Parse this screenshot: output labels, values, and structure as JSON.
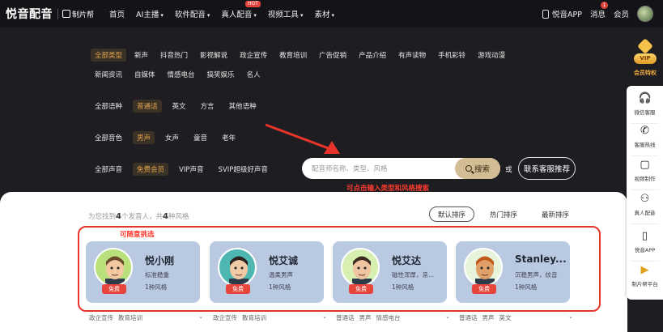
{
  "header": {
    "logo_text": "悦音配音",
    "logo_sub": "制片帮",
    "nav": [
      {
        "label": "首页",
        "chevron": false,
        "hot": ""
      },
      {
        "label": "AI主播",
        "chevron": true,
        "hot": ""
      },
      {
        "label": "软件配音",
        "chevron": true,
        "hot": ""
      },
      {
        "label": "真人配音",
        "chevron": true,
        "hot": "HOT"
      },
      {
        "label": "视频工具",
        "chevron": true,
        "hot": ""
      },
      {
        "label": "素材",
        "chevron": true,
        "hot": ""
      }
    ],
    "app_label": "悦音APP",
    "messages_label": "消息",
    "messages_badge": "1",
    "member_label": "会员"
  },
  "filters": {
    "type_row1": [
      "全部类型",
      "新声",
      "抖音热门",
      "影视解说",
      "政企宣传",
      "教育培训",
      "广告促销",
      "产品介绍",
      "有声读物",
      "手机彩铃",
      "游戏动漫"
    ],
    "type_row2": [
      "新闻资讯",
      "自媒体",
      "情感电台",
      "搞笑娱乐",
      "名人"
    ],
    "language": [
      "全部语种",
      "普通话",
      "英文",
      "方言",
      "其他语种"
    ],
    "voice": [
      "全部音色",
      "男声",
      "女声",
      "童音",
      "老年"
    ],
    "member": [
      "全部声音",
      "免费会员",
      "VIP声音",
      "SVIP超级好声音"
    ]
  },
  "search": {
    "placeholder": "配音师名称、类型、风格",
    "button_label": "搜索",
    "or_label": "或",
    "cs_button_label": "联系客服推荐",
    "hint": "可点击输入类型和风格搜索"
  },
  "results": {
    "count_prefix": "为您找到",
    "count_voices": "4",
    "count_mid": "个发音人，共",
    "count_styles": "4",
    "count_suffix": "种风格",
    "sort_options": [
      "默认排序",
      "热门排序",
      "最新排序"
    ],
    "pick_label": "可随意挑选",
    "free_label": "免费",
    "cards": [
      {
        "name": "悦小刚",
        "desc": "标准稳重",
        "styles": "1种风格",
        "tags": [
          "政企宣传",
          "教育培训"
        ],
        "avatar_bg": "#b9e07a",
        "skin": "#f1c8a0",
        "hair": "#6b4a2b"
      },
      {
        "name": "悦艾诚",
        "desc": "温柔男声",
        "styles": "1种风格",
        "tags": [
          "政企宣传",
          "教育培训"
        ],
        "avatar_bg": "#4fb7b1",
        "skin": "#f0c9a6",
        "hair": "#2a2321"
      },
      {
        "name": "悦艾达",
        "desc": "磁性浑厚，亲...",
        "styles": "1种风格",
        "tags": [
          "普通话",
          "男声",
          "情感电台"
        ],
        "avatar_bg": "#d7efb0",
        "skin": "#efc4a0",
        "hair": "#3a2a22"
      },
      {
        "name": "Stanley...",
        "desc": "沉稳男声，纹音",
        "styles": "1种风格",
        "tags": [
          "普通话",
          "男声",
          "英文"
        ],
        "avatar_bg": "#e7f3da",
        "skin": "#e1a06a",
        "hair": "#c05a1a"
      }
    ]
  },
  "rail": {
    "vip_badge": "VIP",
    "vip_label": "会员特权",
    "items": [
      {
        "label": "微信客服",
        "icon": "headset-icon",
        "glyph": "🎧"
      },
      {
        "label": "客服热线",
        "icon": "phone-icon",
        "glyph": "✆"
      },
      {
        "label": "视频制作",
        "icon": "video-icon",
        "glyph": "▢"
      },
      {
        "label": "真人配音",
        "icon": "person-icon",
        "glyph": "⚇"
      },
      {
        "label": "悦音APP",
        "icon": "mobile-icon",
        "glyph": "▯"
      },
      {
        "label": "制片帮平台",
        "icon": "play-circle-icon",
        "glyph": "▶"
      }
    ]
  },
  "colors": {
    "accent": "#e2a24f",
    "red": "#e8332a",
    "card": "#b9c9e2"
  }
}
